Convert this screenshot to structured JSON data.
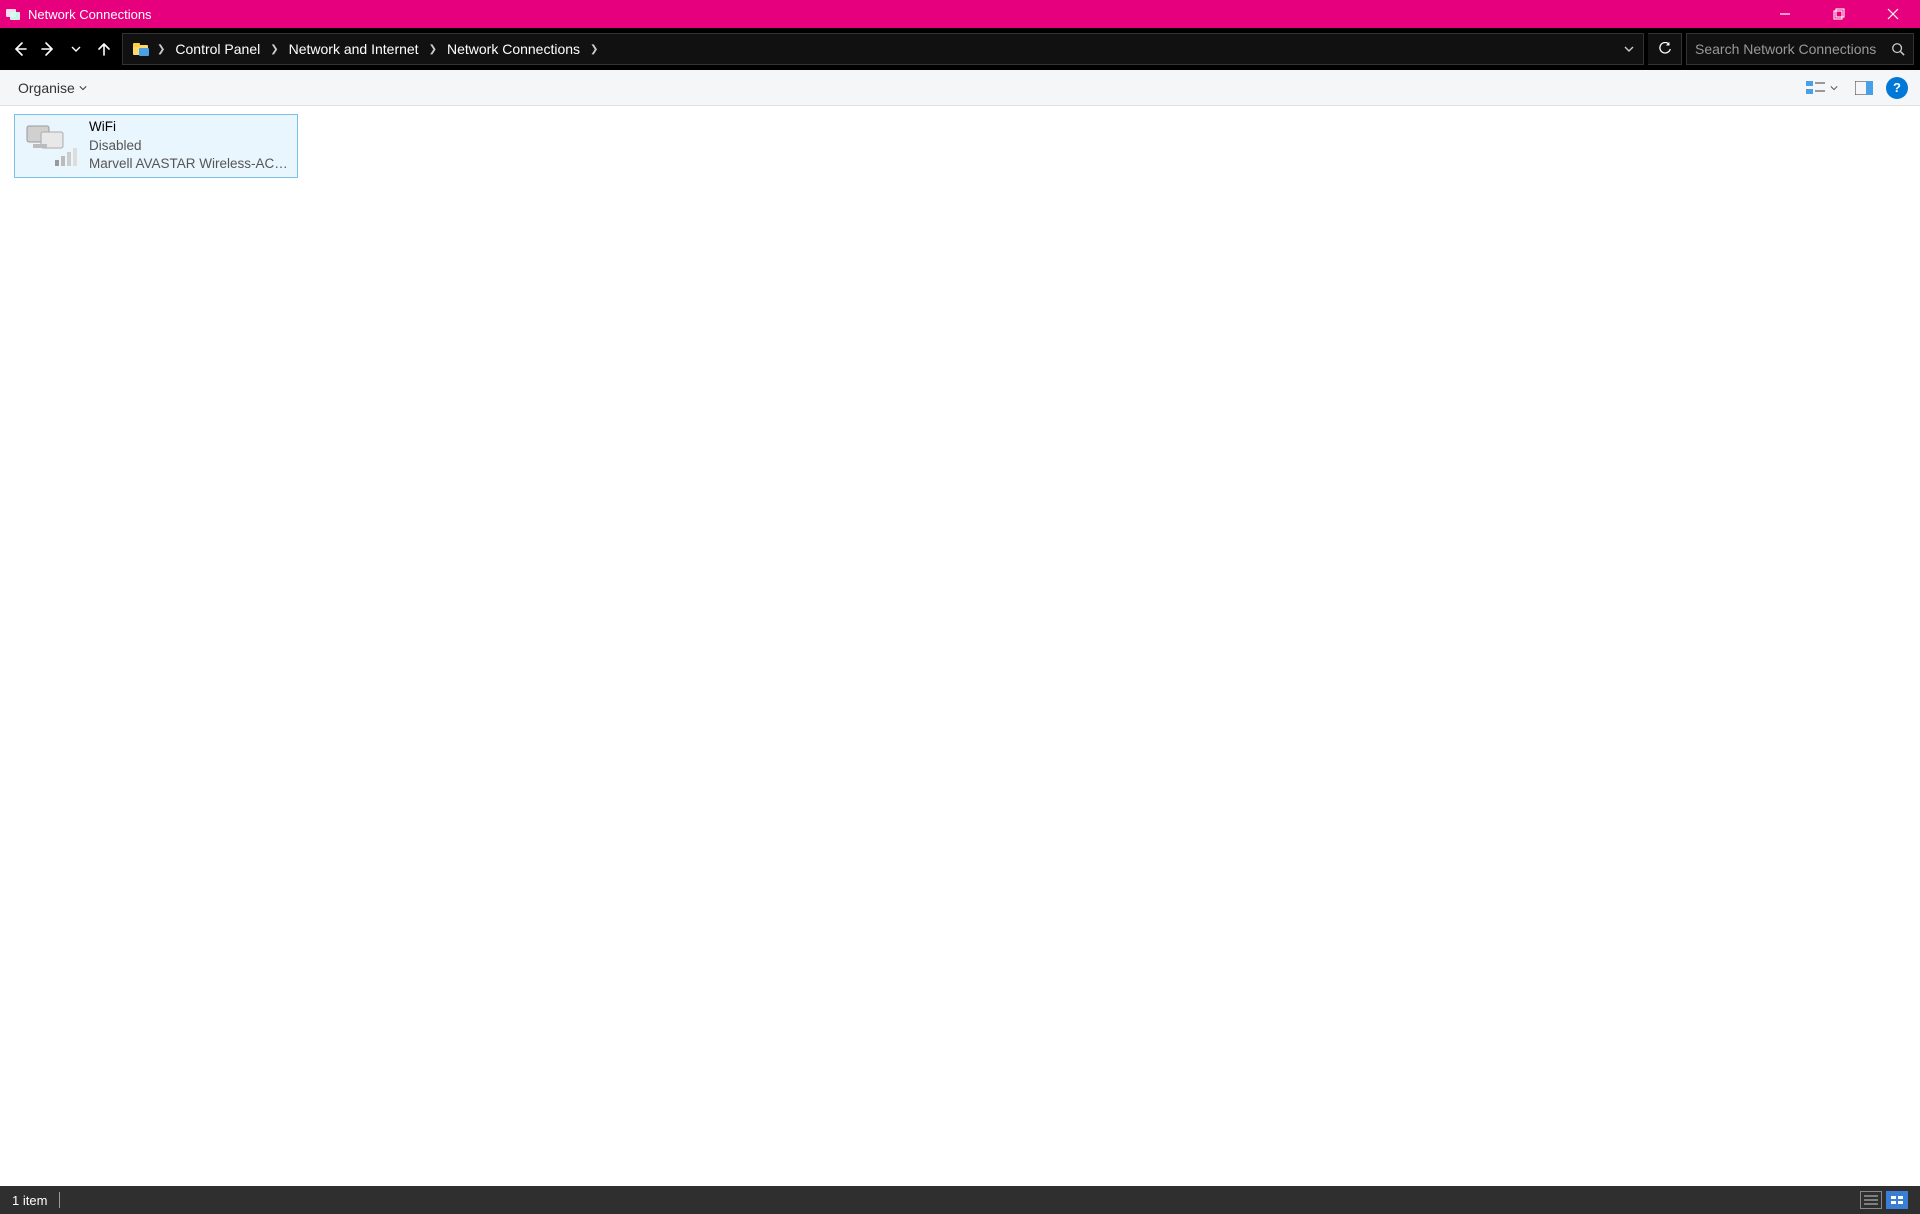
{
  "window": {
    "title": "Network Connections"
  },
  "breadcrumbs": {
    "item0": "Control Panel",
    "item1": "Network and Internet",
    "item2": "Network Connections"
  },
  "search": {
    "placeholder": "Search Network Connections"
  },
  "commandbar": {
    "organise_label": "Organise"
  },
  "connections": {
    "item0": {
      "name": "WiFi",
      "status": "Disabled",
      "device": "Marvell AVASTAR Wireless-AC ..."
    }
  },
  "statusbar": {
    "item_count": "1 item"
  }
}
